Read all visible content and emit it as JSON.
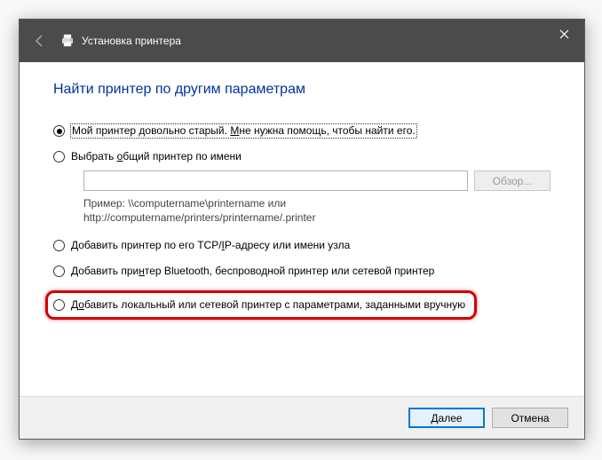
{
  "titlebar": {
    "title": "Установка принтера"
  },
  "heading": "Найти принтер по другим параметрам",
  "options": {
    "old_prefix": "Мой принтер довольно старый. ",
    "old_underlined": "М",
    "old_suffix": "не нужна помощь, чтобы найти его.",
    "shared_prefix": "Выбрать ",
    "shared_u": "о",
    "shared_suffix": "бщий принтер по имени",
    "browse": "Обзор...",
    "example_l1": "Пример: \\\\computername\\printername или",
    "example_l2": "http://computername/printers/printername/.printer",
    "tcp_pre": "Добавить принтер по его TCP/",
    "tcp_u": "I",
    "tcp_post": "P-адресу или имени узла",
    "bt_pre": "Добавить при",
    "bt_u": "н",
    "bt_post": "тер Bluetooth, беспроводной принтер или сетевой принтер",
    "local_pre": "Д",
    "local_u": "о",
    "local_post": "бавить локальный или сетевой принтер с параметрами, заданными вручную"
  },
  "footer": {
    "next_u": "Д",
    "next_post": "алее",
    "cancel": "Отмена"
  }
}
